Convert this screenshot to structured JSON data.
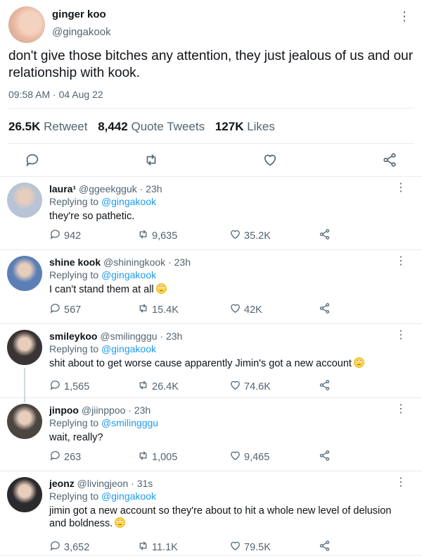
{
  "main_tweet": {
    "name": "ginger koo",
    "handle": "@gingakook",
    "text": "don't give those bitches any attention, they just jealous of us and our relationship with kook.",
    "time": "09:58 AM · 04 Aug 22",
    "retweets": "26.5K",
    "retweets_label": "Retweet",
    "quotes": "8,442",
    "quotes_label": "Quote Tweets",
    "likes": "127K",
    "likes_label": "Likes"
  },
  "replies": [
    {
      "name": "laura¹",
      "meta": "@ggeekgguk · 23h",
      "replying_label": "Replying to",
      "replying_to": "@gingakook",
      "text": "they're so pathetic.",
      "emoji": "",
      "replies": "942",
      "retweets": "9,635",
      "likes": "35.2K",
      "avatar_color": "#b8c4d6"
    },
    {
      "name": "shine kook",
      "meta": "@shiningkook · 23h",
      "replying_label": "Replying to",
      "replying_to": "@gingakook",
      "text": "I can't stand them at all",
      "emoji": "crying-face",
      "replies": "567",
      "retweets": "15.4K",
      "likes": "42K",
      "avatar_color": "#5b7fb5"
    },
    {
      "name": "smileykoo",
      "meta": "@smilingggu · 23h",
      "replying_label": "Replying to",
      "replying_to": "@gingakook",
      "text": "shit about to get worse cause apparently Jimin's got a new account",
      "emoji": "rolling-eyes-face",
      "replies": "1,565",
      "retweets": "26.4K",
      "likes": "74.6K",
      "avatar_color": "#3a3434"
    },
    {
      "name": "jinpoo",
      "meta": "@jiinppoo · 23h",
      "replying_label": "Replying to",
      "replying_to": "@smilingggu",
      "text": "wait, really?",
      "emoji": "",
      "replies": "263",
      "retweets": "1,005",
      "likes": "9,465",
      "avatar_color": "#4a4540"
    },
    {
      "name": "jeonz",
      "meta": "@livingjeon · 31s",
      "replying_label": "Replying to",
      "replying_to": "@gingakook",
      "text": "jimin got a new account so they're about to hit a whole new level of delusion and boldness.",
      "emoji": "rolling-eyes-face",
      "replies": "3,652",
      "retweets": "11.1K",
      "likes": "79.5K",
      "avatar_color": "#2b2a2e"
    }
  ],
  "colors": {
    "link": "#1d9bf0",
    "secondary_text": "#536471",
    "divider": "#e6ecf0"
  }
}
